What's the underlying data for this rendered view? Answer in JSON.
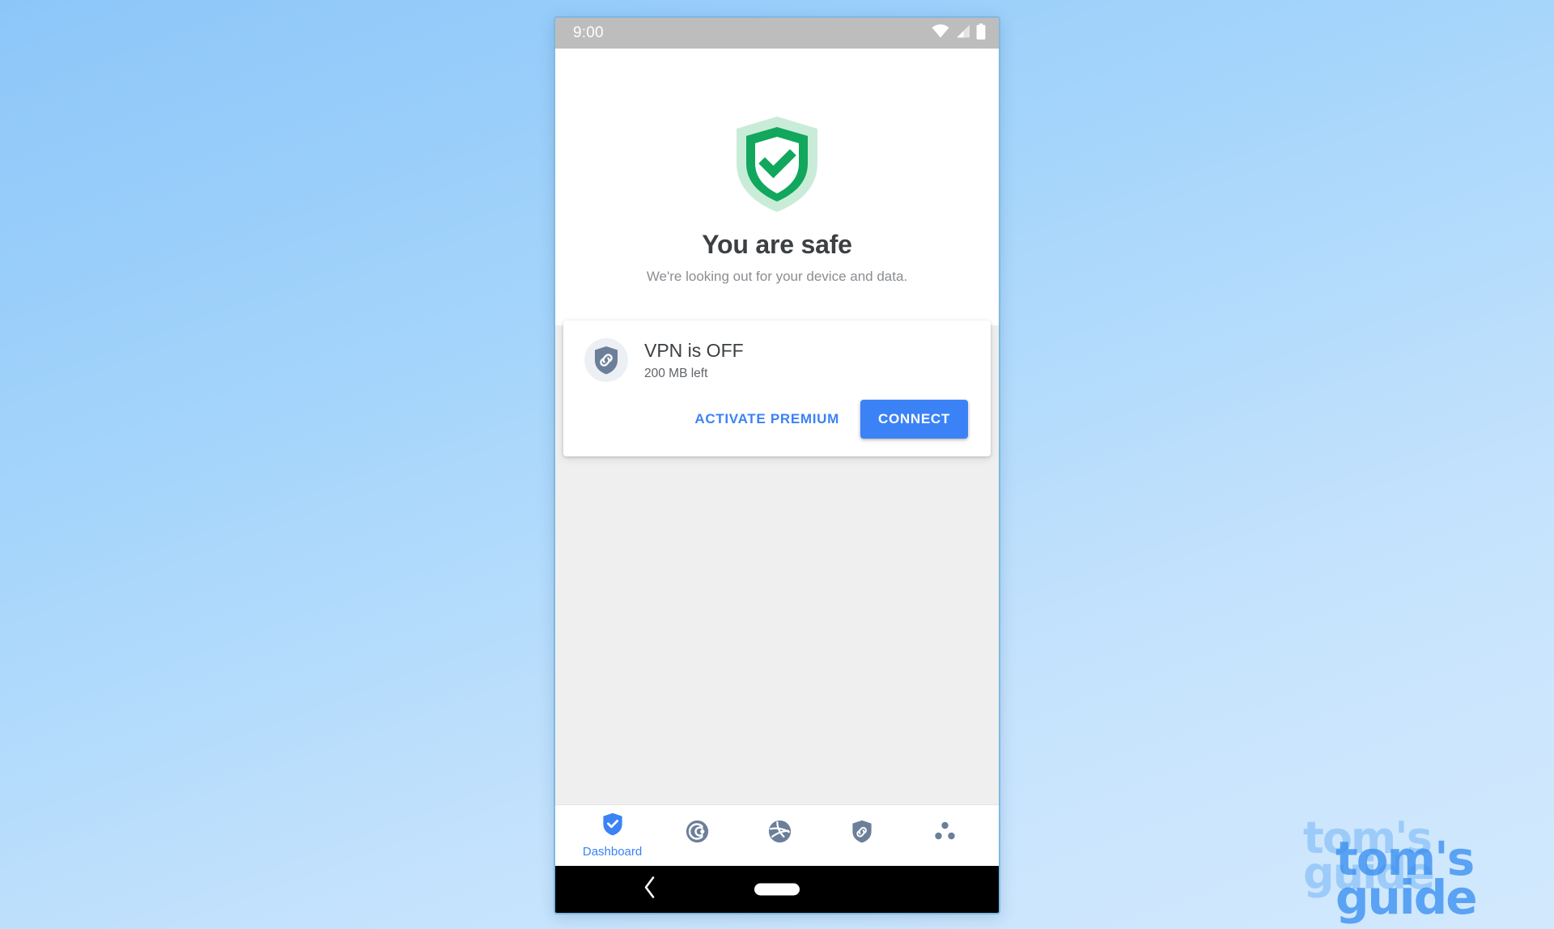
{
  "background": {
    "gradient_from": "#8cc6f9",
    "gradient_to": "#d2e9fd"
  },
  "watermark": {
    "line1": "tom's",
    "line2": "guide",
    "color": "#388ef0"
  },
  "status_bar": {
    "time": "9:00",
    "icons": [
      "wifi-icon",
      "cellular-signal-icon",
      "battery-icon"
    ],
    "background": "#bdbdbd"
  },
  "hero": {
    "icon": "shield-check-icon",
    "icon_color": "#11a75c",
    "icon_outer_color": "#c9ecd9",
    "title": "You are safe",
    "subtitle": "We're looking out for your device and data."
  },
  "vpn_card": {
    "icon": "vpn-shield-link-icon",
    "icon_color": "#6b7f99",
    "title": "VPN is OFF",
    "subtitle": "200 MB left",
    "activate_label": "ACTIVATE PREMIUM",
    "connect_label": "CONNECT",
    "accent_color": "#3b82f6"
  },
  "bottom_nav": {
    "active_color": "#3b82f6",
    "inactive_color": "#6b7f99",
    "items": [
      {
        "id": "dashboard",
        "label": "Dashboard",
        "icon": "shield-check-icon",
        "active": true
      },
      {
        "id": "cleaner",
        "label": "",
        "icon": "cleaner-circle-icon",
        "active": false
      },
      {
        "id": "network",
        "label": "",
        "icon": "globe-network-icon",
        "active": false
      },
      {
        "id": "vpn",
        "label": "",
        "icon": "vpn-shield-link-icon",
        "active": false
      },
      {
        "id": "more",
        "label": "",
        "icon": "more-dots-icon",
        "active": false
      }
    ]
  },
  "android_nav": {
    "back": "back-chevron-icon",
    "home": "home-pill-icon"
  }
}
